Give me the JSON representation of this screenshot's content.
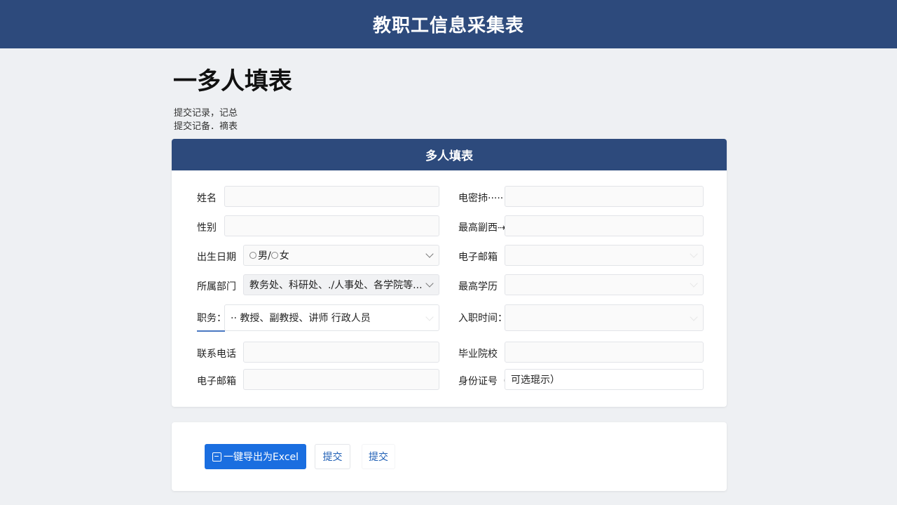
{
  "header": {
    "title": "教职工信息采集表"
  },
  "page": {
    "heading": "一多人填表",
    "subtext_1": "提交记录，记总",
    "subtext_2": "提交记备．䙗表"
  },
  "form": {
    "title": "多人填表",
    "left_fields": [
      {
        "label": "姓名",
        "value": ""
      },
      {
        "label": "性别",
        "value": ""
      },
      {
        "label": "出生日期",
        "value": "男/",
        "value_2": "女"
      },
      {
        "label": "所属部门",
        "value": "教务处、科研处、./人事处、各学院等..."
      },
      {
        "label": "职务：",
        "value": "·· 教授、副教授、讲师  行政人员"
      },
      {
        "label": "联系电话",
        "value": ""
      },
      {
        "label": "电子邮箱",
        "value": ""
      }
    ],
    "right_fields": [
      {
        "label": "电密㧊·····",
        "value": ""
      },
      {
        "label": "最高㓯西⇢",
        "value": ""
      },
      {
        "label": "电子邮箱",
        "value": ""
      },
      {
        "label": "最高学历",
        "value": ""
      },
      {
        "label": "入职时间：",
        "value": ""
      },
      {
        "label": "毕业院校",
        "value": ""
      },
      {
        "label": "身份证号（",
        "value": "可选琨示）"
      }
    ]
  },
  "actions": {
    "export_label": "一键导出为Excel",
    "submit_label_1": "提交",
    "submit_label_2": "提交"
  },
  "colors": {
    "brand": "#2d4a7c",
    "primary_button": "#1a6ee0",
    "link_text": "#1f5fb5"
  },
  "icons": {
    "export": "excel-icon",
    "dropdown": "chevron-down-icon",
    "radio": "radio-icon"
  }
}
